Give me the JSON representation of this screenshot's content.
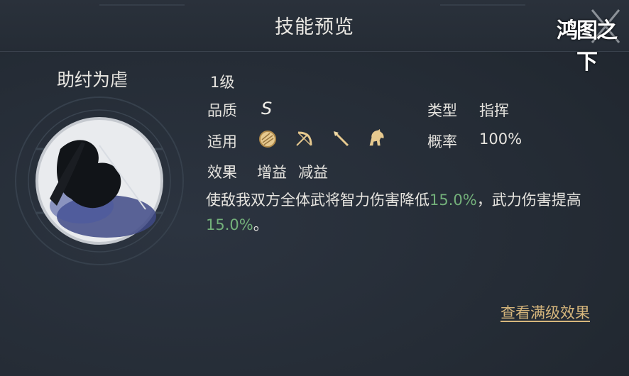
{
  "header": {
    "title": "技能预览",
    "logo_text": "鸿图之下"
  },
  "skill": {
    "name": "助纣为虐",
    "level": "1级",
    "quality_label": "品质",
    "quality_value": "S",
    "type_label": "类型",
    "type_value": "指挥",
    "applicable_label": "适用",
    "applicable_icons": [
      "shield-icon",
      "bow-icon",
      "spear-icon",
      "horse-icon"
    ],
    "probability_label": "概率",
    "probability_value": "100%",
    "effect_label": "效果",
    "effect_tags": [
      "增益",
      "减益"
    ],
    "description": {
      "part1": "使敌我双方全体武将智力伤害降低",
      "value1": "15.0%",
      "part2": "，武力伤害提高",
      "value2": "15.0%",
      "part3": "。"
    }
  },
  "actions": {
    "view_full_level": "查看满级效果"
  },
  "colors": {
    "highlight_green": "#73b07a",
    "link_gold": "#d6b67c",
    "background": "#262d36"
  }
}
